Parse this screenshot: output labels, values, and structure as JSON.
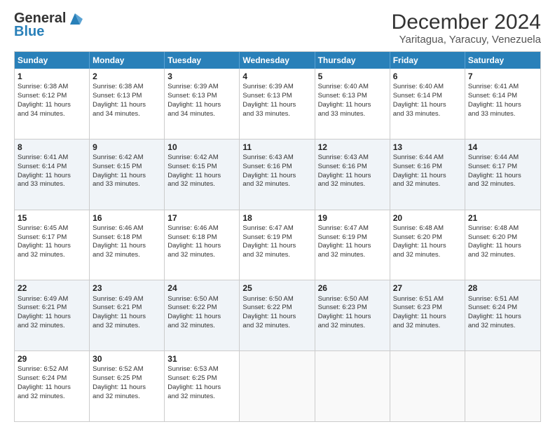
{
  "logo": {
    "general": "General",
    "blue": "Blue"
  },
  "title": "December 2024",
  "subtitle": "Yaritagua, Yaracuy, Venezuela",
  "header_days": [
    "Sunday",
    "Monday",
    "Tuesday",
    "Wednesday",
    "Thursday",
    "Friday",
    "Saturday"
  ],
  "rows": [
    [
      {
        "day": "1",
        "lines": [
          "Sunrise: 6:38 AM",
          "Sunset: 6:12 PM",
          "Daylight: 11 hours",
          "and 34 minutes."
        ]
      },
      {
        "day": "2",
        "lines": [
          "Sunrise: 6:38 AM",
          "Sunset: 6:13 PM",
          "Daylight: 11 hours",
          "and 34 minutes."
        ]
      },
      {
        "day": "3",
        "lines": [
          "Sunrise: 6:39 AM",
          "Sunset: 6:13 PM",
          "Daylight: 11 hours",
          "and 34 minutes."
        ]
      },
      {
        "day": "4",
        "lines": [
          "Sunrise: 6:39 AM",
          "Sunset: 6:13 PM",
          "Daylight: 11 hours",
          "and 33 minutes."
        ]
      },
      {
        "day": "5",
        "lines": [
          "Sunrise: 6:40 AM",
          "Sunset: 6:13 PM",
          "Daylight: 11 hours",
          "and 33 minutes."
        ]
      },
      {
        "day": "6",
        "lines": [
          "Sunrise: 6:40 AM",
          "Sunset: 6:14 PM",
          "Daylight: 11 hours",
          "and 33 minutes."
        ]
      },
      {
        "day": "7",
        "lines": [
          "Sunrise: 6:41 AM",
          "Sunset: 6:14 PM",
          "Daylight: 11 hours",
          "and 33 minutes."
        ]
      }
    ],
    [
      {
        "day": "8",
        "lines": [
          "Sunrise: 6:41 AM",
          "Sunset: 6:14 PM",
          "Daylight: 11 hours",
          "and 33 minutes."
        ]
      },
      {
        "day": "9",
        "lines": [
          "Sunrise: 6:42 AM",
          "Sunset: 6:15 PM",
          "Daylight: 11 hours",
          "and 33 minutes."
        ]
      },
      {
        "day": "10",
        "lines": [
          "Sunrise: 6:42 AM",
          "Sunset: 6:15 PM",
          "Daylight: 11 hours",
          "and 32 minutes."
        ]
      },
      {
        "day": "11",
        "lines": [
          "Sunrise: 6:43 AM",
          "Sunset: 6:16 PM",
          "Daylight: 11 hours",
          "and 32 minutes."
        ]
      },
      {
        "day": "12",
        "lines": [
          "Sunrise: 6:43 AM",
          "Sunset: 6:16 PM",
          "Daylight: 11 hours",
          "and 32 minutes."
        ]
      },
      {
        "day": "13",
        "lines": [
          "Sunrise: 6:44 AM",
          "Sunset: 6:16 PM",
          "Daylight: 11 hours",
          "and 32 minutes."
        ]
      },
      {
        "day": "14",
        "lines": [
          "Sunrise: 6:44 AM",
          "Sunset: 6:17 PM",
          "Daylight: 11 hours",
          "and 32 minutes."
        ]
      }
    ],
    [
      {
        "day": "15",
        "lines": [
          "Sunrise: 6:45 AM",
          "Sunset: 6:17 PM",
          "Daylight: 11 hours",
          "and 32 minutes."
        ]
      },
      {
        "day": "16",
        "lines": [
          "Sunrise: 6:46 AM",
          "Sunset: 6:18 PM",
          "Daylight: 11 hours",
          "and 32 minutes."
        ]
      },
      {
        "day": "17",
        "lines": [
          "Sunrise: 6:46 AM",
          "Sunset: 6:18 PM",
          "Daylight: 11 hours",
          "and 32 minutes."
        ]
      },
      {
        "day": "18",
        "lines": [
          "Sunrise: 6:47 AM",
          "Sunset: 6:19 PM",
          "Daylight: 11 hours",
          "and 32 minutes."
        ]
      },
      {
        "day": "19",
        "lines": [
          "Sunrise: 6:47 AM",
          "Sunset: 6:19 PM",
          "Daylight: 11 hours",
          "and 32 minutes."
        ]
      },
      {
        "day": "20",
        "lines": [
          "Sunrise: 6:48 AM",
          "Sunset: 6:20 PM",
          "Daylight: 11 hours",
          "and 32 minutes."
        ]
      },
      {
        "day": "21",
        "lines": [
          "Sunrise: 6:48 AM",
          "Sunset: 6:20 PM",
          "Daylight: 11 hours",
          "and 32 minutes."
        ]
      }
    ],
    [
      {
        "day": "22",
        "lines": [
          "Sunrise: 6:49 AM",
          "Sunset: 6:21 PM",
          "Daylight: 11 hours",
          "and 32 minutes."
        ]
      },
      {
        "day": "23",
        "lines": [
          "Sunrise: 6:49 AM",
          "Sunset: 6:21 PM",
          "Daylight: 11 hours",
          "and 32 minutes."
        ]
      },
      {
        "day": "24",
        "lines": [
          "Sunrise: 6:50 AM",
          "Sunset: 6:22 PM",
          "Daylight: 11 hours",
          "and 32 minutes."
        ]
      },
      {
        "day": "25",
        "lines": [
          "Sunrise: 6:50 AM",
          "Sunset: 6:22 PM",
          "Daylight: 11 hours",
          "and 32 minutes."
        ]
      },
      {
        "day": "26",
        "lines": [
          "Sunrise: 6:50 AM",
          "Sunset: 6:23 PM",
          "Daylight: 11 hours",
          "and 32 minutes."
        ]
      },
      {
        "day": "27",
        "lines": [
          "Sunrise: 6:51 AM",
          "Sunset: 6:23 PM",
          "Daylight: 11 hours",
          "and 32 minutes."
        ]
      },
      {
        "day": "28",
        "lines": [
          "Sunrise: 6:51 AM",
          "Sunset: 6:24 PM",
          "Daylight: 11 hours",
          "and 32 minutes."
        ]
      }
    ],
    [
      {
        "day": "29",
        "lines": [
          "Sunrise: 6:52 AM",
          "Sunset: 6:24 PM",
          "Daylight: 11 hours",
          "and 32 minutes."
        ]
      },
      {
        "day": "30",
        "lines": [
          "Sunrise: 6:52 AM",
          "Sunset: 6:25 PM",
          "Daylight: 11 hours",
          "and 32 minutes."
        ]
      },
      {
        "day": "31",
        "lines": [
          "Sunrise: 6:53 AM",
          "Sunset: 6:25 PM",
          "Daylight: 11 hours",
          "and 32 minutes."
        ]
      },
      null,
      null,
      null,
      null
    ]
  ]
}
